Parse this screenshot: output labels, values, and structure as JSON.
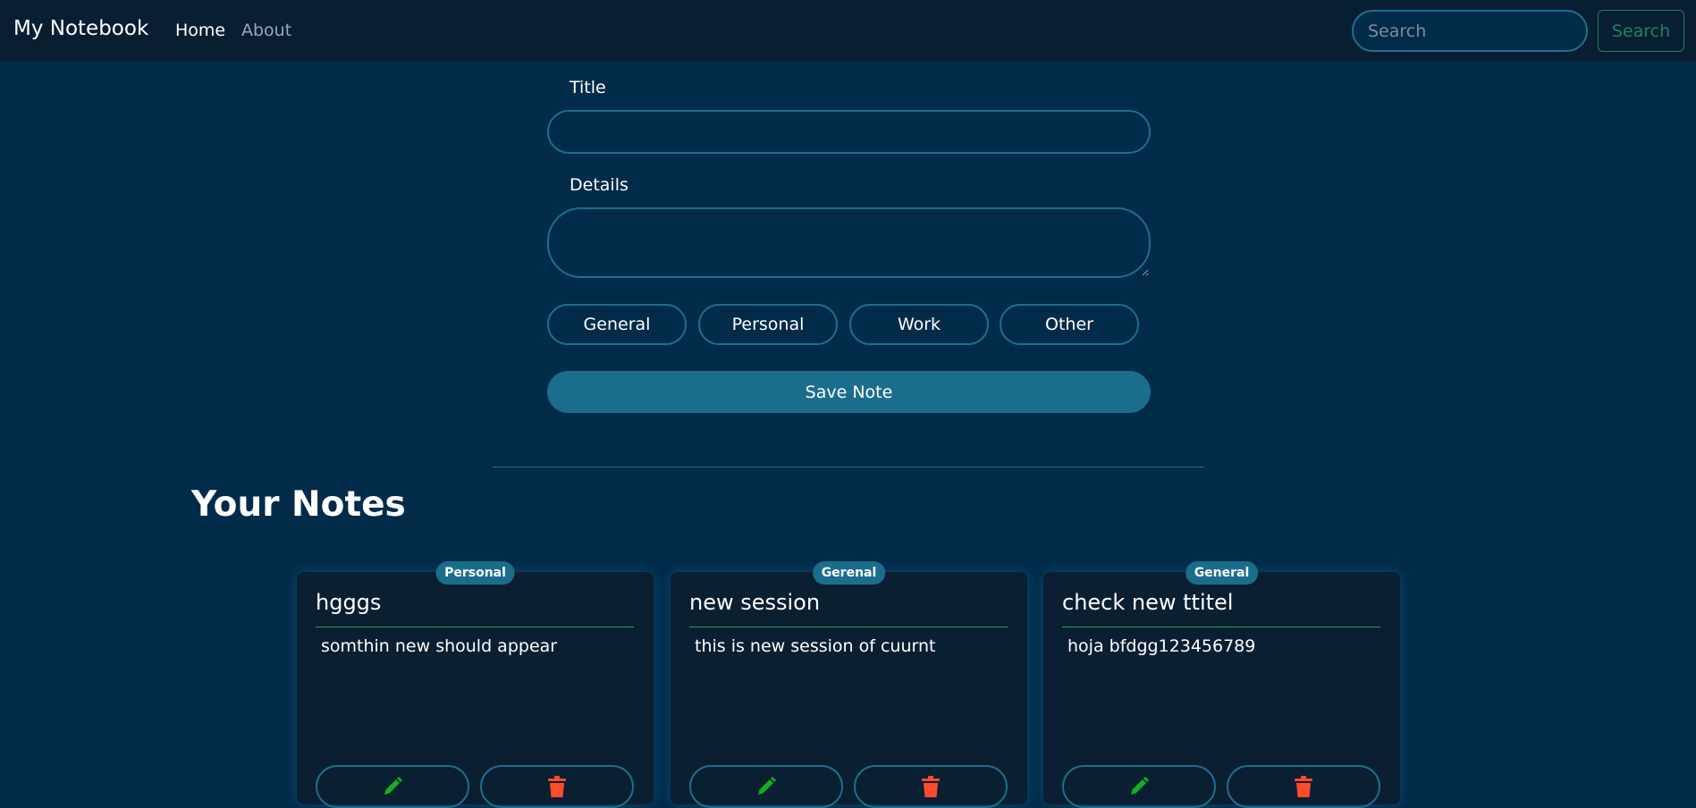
{
  "navbar": {
    "brand": "My Notebook",
    "links": [
      "Home",
      "About"
    ],
    "search_placeholder": "Search",
    "search_button": "Search"
  },
  "form": {
    "title_label": "Title",
    "details_label": "Details",
    "categories": [
      "General",
      "Personal",
      "Work",
      "Other"
    ],
    "save_label": "Save Note"
  },
  "notes_section": {
    "heading": "Your Notes",
    "notes": [
      {
        "tag": "Personal",
        "title": "hgggs",
        "text": "somthin new should appear"
      },
      {
        "tag": "Gerenal",
        "title": "new session",
        "text": "this is new session of cuurnt"
      },
      {
        "tag": "General",
        "title": "check new ttitel",
        "text": "hoja bfdgg123456789"
      }
    ]
  },
  "colors": {
    "background": "#022b4a",
    "navbar": "#081e33",
    "accent": "#1b6e8b",
    "card": "#0b1f33",
    "edit_icon": "#12b01e",
    "delete_icon": "#ff4b2b",
    "search_button": "#198754"
  },
  "icons": {
    "edit": "pencil-icon",
    "delete": "trash-icon"
  }
}
